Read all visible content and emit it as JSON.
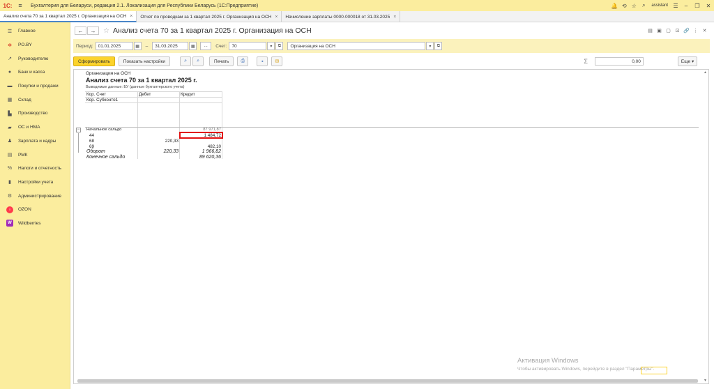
{
  "app": {
    "logo": "1С:",
    "title": "Бухгалтерия для Беларуси, редакция 2.1. Локализация для Республики Беларусь   (1С:Предприятие)",
    "user": "assistant"
  },
  "tabs": [
    {
      "label": "Анализ счета 70 за 1 квартал 2025 г. Организация на ОСН",
      "active": true
    },
    {
      "label": "Отчет по проводкам за 1 квартал 2025 г. Организация на ОСН",
      "active": false
    },
    {
      "label": "Начисление зарплаты 0000-000018 от 31.03.2025",
      "active": false
    }
  ],
  "sidebar": {
    "items": [
      {
        "label": "Главное",
        "icon": "menu-icon"
      },
      {
        "label": "PO.BY",
        "icon": "poby-icon"
      },
      {
        "label": "Руководителю",
        "icon": "chart-icon"
      },
      {
        "label": "Банк и касса",
        "icon": "bank-icon"
      },
      {
        "label": "Покупки и продажи",
        "icon": "cart-icon"
      },
      {
        "label": "Склад",
        "icon": "warehouse-icon"
      },
      {
        "label": "Производство",
        "icon": "factory-icon"
      },
      {
        "label": "ОС и НМА",
        "icon": "truck-icon"
      },
      {
        "label": "Зарплата и кадры",
        "icon": "person-icon"
      },
      {
        "label": "РМК",
        "icon": "register-icon"
      },
      {
        "label": "Налоги и отчетность",
        "icon": "tax-icon"
      },
      {
        "label": "Настройки учета",
        "icon": "book-icon"
      },
      {
        "label": "Администрирование",
        "icon": "gear-icon"
      },
      {
        "label": "OZON",
        "icon": "ozon-icon"
      },
      {
        "label": "Wildberries",
        "icon": "wb-icon"
      }
    ]
  },
  "document": {
    "title": "Анализ счета 70 за 1 квартал 2025 г. Организация на ОСН"
  },
  "filters": {
    "period_label": "Период:",
    "date_from": "01.01.2025",
    "dash": "–",
    "date_to": "31.03.2025",
    "dots": "...",
    "account_label": "Счет:",
    "account": "70",
    "organization": "Организация на ОСН"
  },
  "toolbar": {
    "generate": "Сформировать",
    "settings": "Показать настройки",
    "print": "Печать",
    "sum_symbol": "Σ",
    "sum_value": "0,00",
    "more": "Еще"
  },
  "report": {
    "org": "Организация на ОСН",
    "title": "Анализ счета 70 за 1 квартал 2025 г.",
    "output": "Выводимые данные:  БУ (данные бухгалтерского учета)",
    "headers": {
      "kor_schet": "Кор. Счет",
      "kor_subkonto": "Кор. Субконто1",
      "debet": "Дебет",
      "kredit": "Кредит"
    },
    "rows": [
      {
        "label": "Начальное сальдо",
        "debet": "",
        "kredit": "87 971,87",
        "italic": false
      },
      {
        "label": "44",
        "debet": "",
        "kredit": "1 484,72",
        "italic": false
      },
      {
        "label": "68",
        "debet": "220,33",
        "kredit": "",
        "italic": false
      },
      {
        "label": "69",
        "debet": "",
        "kredit": "482,10",
        "italic": false
      },
      {
        "label": "Оборот",
        "debet": "220,33",
        "kredit": "1 966,82",
        "italic": true
      },
      {
        "label": "Конечное сальдо",
        "debet": "",
        "kredit": "89 620,36",
        "italic": true
      }
    ]
  },
  "watermark": {
    "line1": "Активация Windows",
    "line2": "Чтобы активировать Windows, перейдите в раздел \"Параметры\"."
  }
}
